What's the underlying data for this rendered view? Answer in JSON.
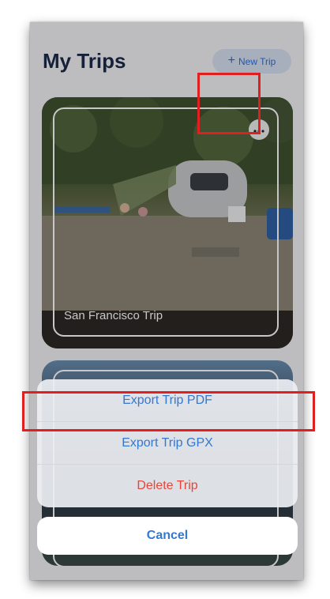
{
  "header": {
    "title": "My Trips",
    "new_trip_label": "New Trip",
    "new_trip_icon": "plus-icon"
  },
  "trips": [
    {
      "name": "San Francisco Trip",
      "menu_icon": "ellipsis-icon"
    },
    {
      "name": ""
    }
  ],
  "action_sheet": {
    "options": [
      {
        "label": "Export Trip PDF",
        "style": "default"
      },
      {
        "label": "Export Trip GPX",
        "style": "default"
      },
      {
        "label": "Delete Trip",
        "style": "destructive"
      }
    ],
    "cancel_label": "Cancel"
  },
  "colors": {
    "accent": "#3478d0",
    "destructive": "#e5453a",
    "highlight": "#e02020",
    "title": "#1c2a4a"
  }
}
